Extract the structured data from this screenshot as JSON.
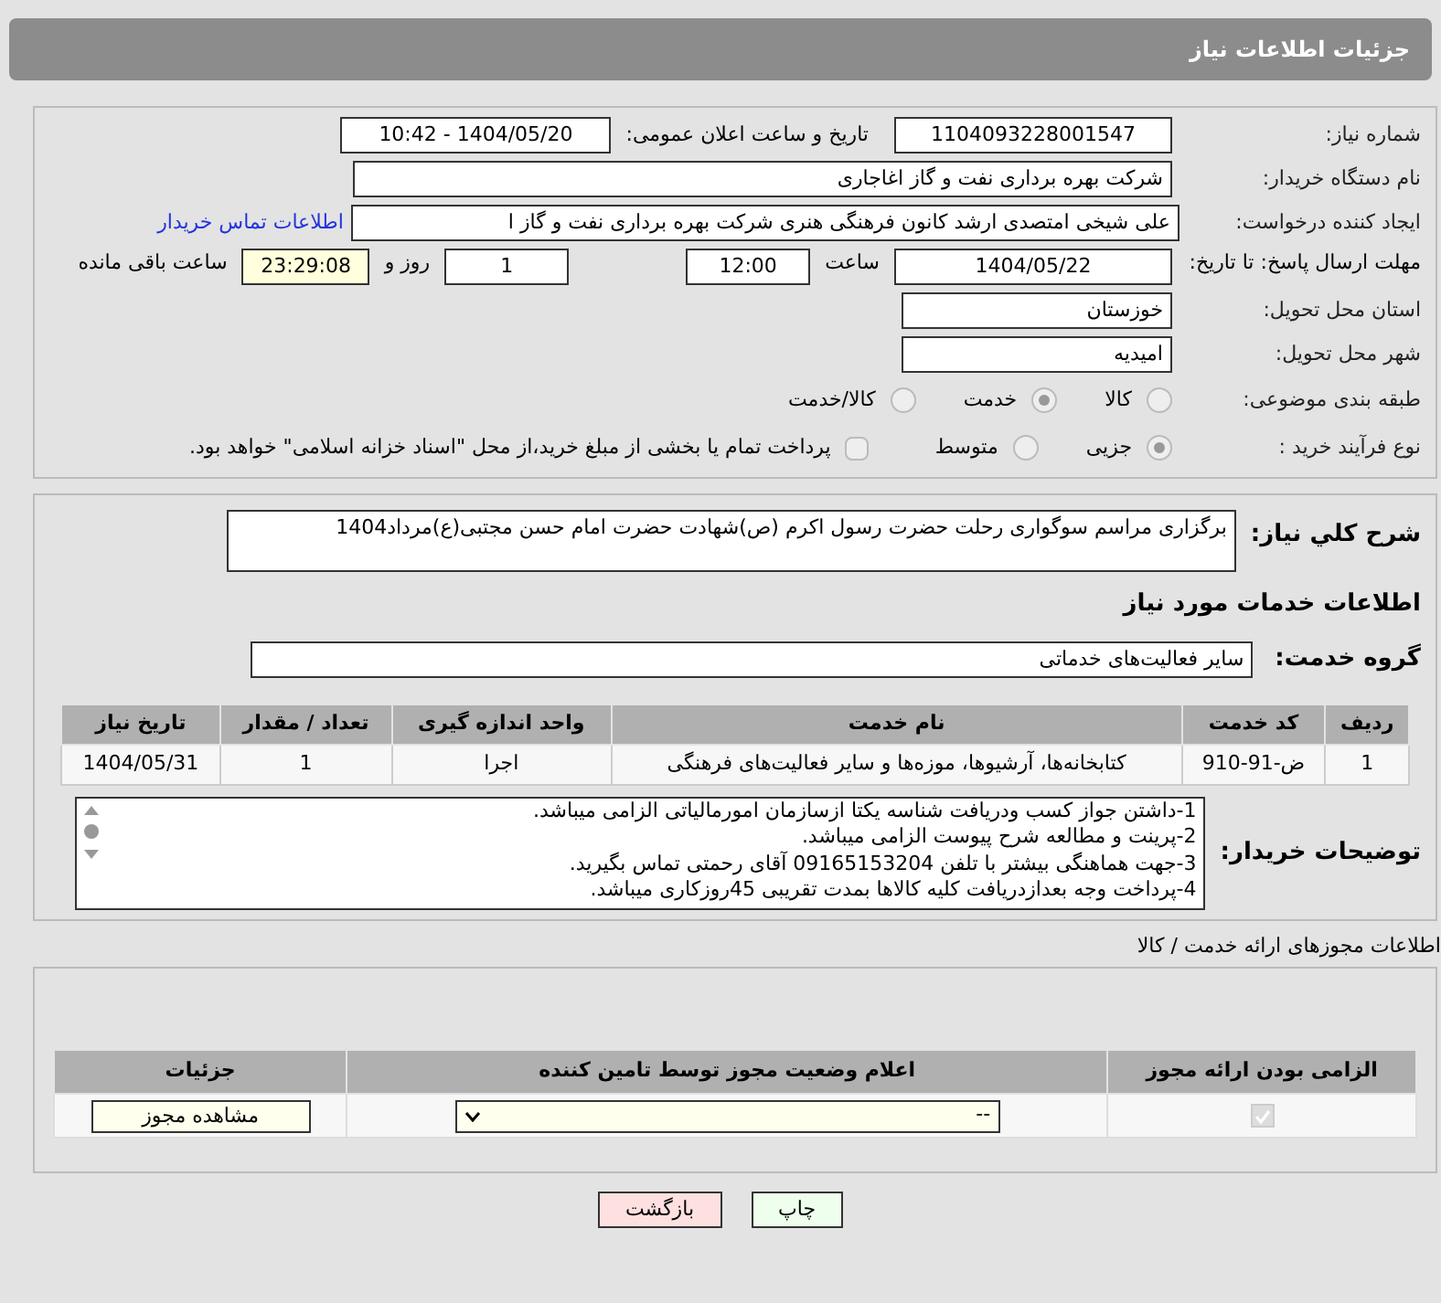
{
  "header": {
    "title": "جزئیات اطلاعات نیاز"
  },
  "need": {
    "number_label": "شماره نیاز:",
    "number": "1104093228001547",
    "announce_label": "تاریخ و ساعت اعلان عمومی:",
    "announce": "1404/05/20 - 10:42",
    "buyer_label": "نام دستگاه خریدار:",
    "buyer": "شرکت بهره برداری نفت و گاز اغاجاری",
    "creator_label": "ایجاد کننده درخواست:",
    "creator": "علی شیخی امتصدی ارشد کانون فرهنگی هنری شرکت بهره برداری نفت و گاز ا",
    "contact_link": "اطلاعات تماس خریدار",
    "deadline_label": "مهلت ارسال پاسخ: تا تاریخ:",
    "deadline_date": "1404/05/22",
    "time_label": "ساعت",
    "deadline_time": "12:00",
    "days": "1",
    "days_label": "روز و",
    "remaining": "23:29:08",
    "remaining_label": "ساعت باقی مانده",
    "province_label": "استان محل تحویل:",
    "province": "خوزستان",
    "city_label": "شهر محل تحویل:",
    "city": "امیدیه",
    "category_label": "طبقه بندی موضوعی:",
    "categories": [
      {
        "label": "کالا",
        "selected": false
      },
      {
        "label": "خدمت",
        "selected": true
      },
      {
        "label": "کالا/خدمت",
        "selected": false
      }
    ],
    "process_label": "نوع فرآیند خرید :",
    "processes": [
      {
        "label": "جزیی",
        "selected": true
      },
      {
        "label": "متوسط",
        "selected": false
      }
    ],
    "treasury": {
      "label": "پرداخت تمام یا بخشی از مبلغ خرید،از محل \"اسناد خزانه اسلامی\" خواهد بود.",
      "checked": false
    }
  },
  "services": {
    "description_label": "شرح کلي نياز:",
    "description": "برگزاری مراسم سوگواری رحلت حضرت رسول اکرم (ص)شهادت حضرت امام حسن مجتبی(ع)مرداد1404",
    "section_title": "اطلاعات خدمات مورد نیاز",
    "group_label": "گروه خدمت:",
    "group": "سایر فعالیت‌های خدماتی",
    "table": {
      "columns": [
        "ردیف",
        "کد خدمت",
        "نام خدمت",
        "واحد اندازه گیری",
        "تعداد / مقدار",
        "تاریخ نیاز"
      ],
      "rows": [
        [
          "1",
          "ض-91-910",
          "کتابخانه‌ها، آرشیوها، موزه‌ها و سایر فعالیت‌های فرهنگی",
          "اجرا",
          "1",
          "1404/05/31"
        ]
      ]
    },
    "notes_label": "توضیحات خریدار:",
    "notes": [
      "1-داشتن جواز کسب ودریافت شناسه یکتا ازسازمان امورمالیاتی الزامی میباشد.",
      "2-پرینت و مطالعه شرح  پیوست الزامی میباشد.",
      "3-جهت هماهنگی بیشتر با تلفن 09165153204 آقای رحمتی تماس بگیرید.",
      "4-پرداخت وجه بعدازدریافت کلیه کالاها بمدت تقریبی 45روزکاری میباشد."
    ]
  },
  "licenses": {
    "title": "اطلاعات مجوزهای ارائه خدمت / کالا",
    "columns": [
      "الزامی بودن ارائه مجوز",
      "اعلام وضعیت مجوز توسط تامین کننده",
      "جزئیات"
    ],
    "rows": [
      {
        "required": true,
        "status": "--",
        "button": "مشاهده مجوز"
      }
    ]
  },
  "buttons": [
    {
      "label": "چاپ",
      "kind": "print"
    },
    {
      "label": "بازگشت",
      "kind": "back"
    }
  ]
}
